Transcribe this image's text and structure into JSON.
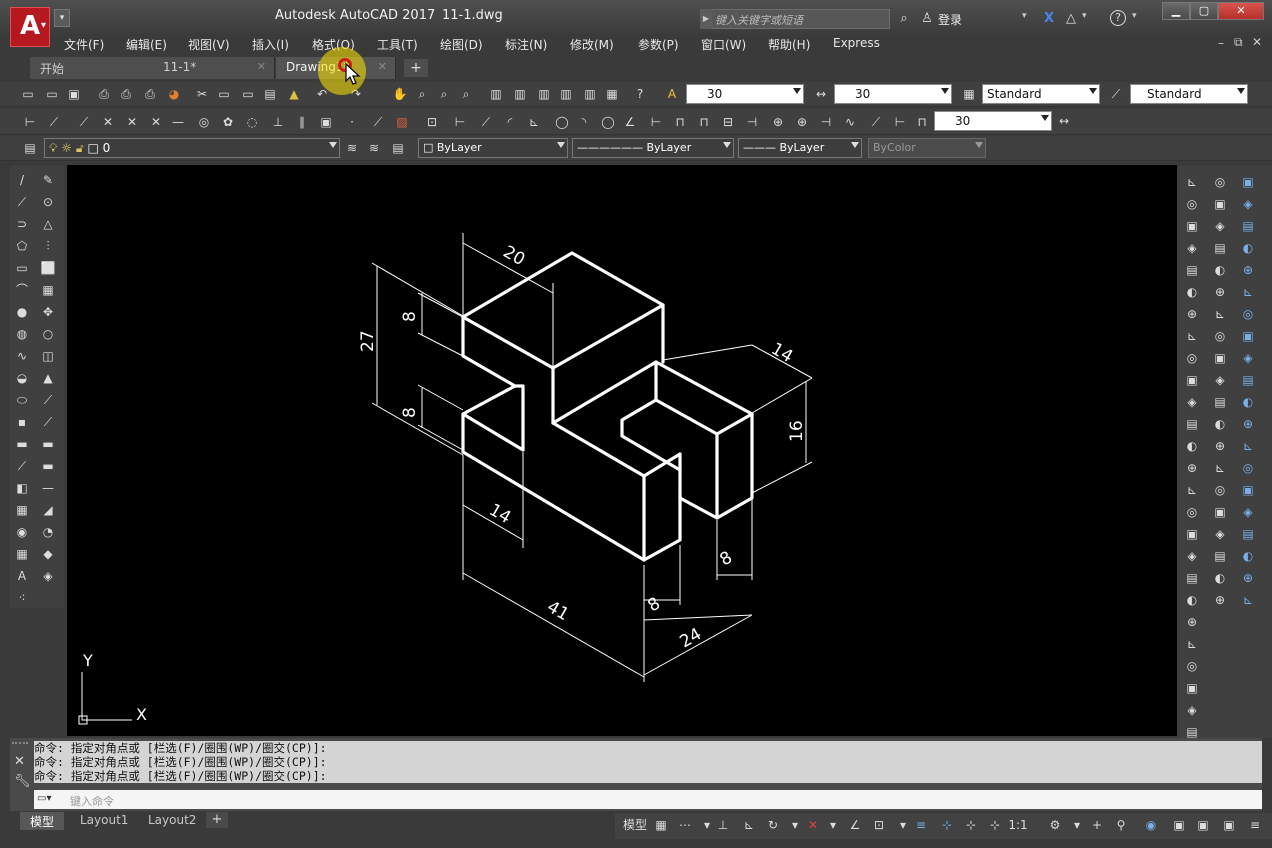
{
  "title": {
    "app": "Autodesk AutoCAD 2017",
    "file": "11-1.dwg",
    "search_placeholder": "键入关键字或短语",
    "login": "登录"
  },
  "menu": [
    "文件(F)",
    "编辑(E)",
    "视图(V)",
    "插入(I)",
    "格式(O)",
    "工具(T)",
    "绘图(D)",
    "标注(N)",
    "修改(M)",
    "参数(P)",
    "窗口(W)",
    "帮助(H)",
    "Express"
  ],
  "tabs": [
    {
      "label": "开始"
    },
    {
      "label": "11-1*"
    },
    {
      "label": "Drawing1*"
    }
  ],
  "toolbar1": {
    "text_height": "30",
    "dim_value": "30",
    "text_style": "Standard",
    "dim_style": "Standard"
  },
  "toolbar2": {
    "scale_value": "30"
  },
  "layers": {
    "current": "0",
    "color": "ByLayer",
    "linetype": "ByLayer",
    "lineweight": "ByLayer",
    "plotstyle": "ByColor"
  },
  "dimensions": {
    "d20": "20",
    "d8a": "8",
    "d27": "27",
    "d8b": "8",
    "d14a": "14",
    "d16": "16",
    "d14b": "14",
    "d8c": "8",
    "d41": "41",
    "d8d": "8",
    "d24": "24"
  },
  "ucs": {
    "y": "Y",
    "x": "X"
  },
  "command": {
    "lines": [
      "命令: 指定对角点或 [栏选(F)/圈围(WP)/圈交(CP)]:",
      "命令: 指定对角点或 [栏选(F)/圈围(WP)/圈交(CP)]:",
      "命令: 指定对角点或 [栏选(F)/圈围(WP)/圈交(CP)]:"
    ],
    "input_placeholder": "键入命令"
  },
  "layouts": [
    "模型",
    "Layout1",
    "Layout2"
  ],
  "status": {
    "model": "模型",
    "scale": "1:1"
  }
}
